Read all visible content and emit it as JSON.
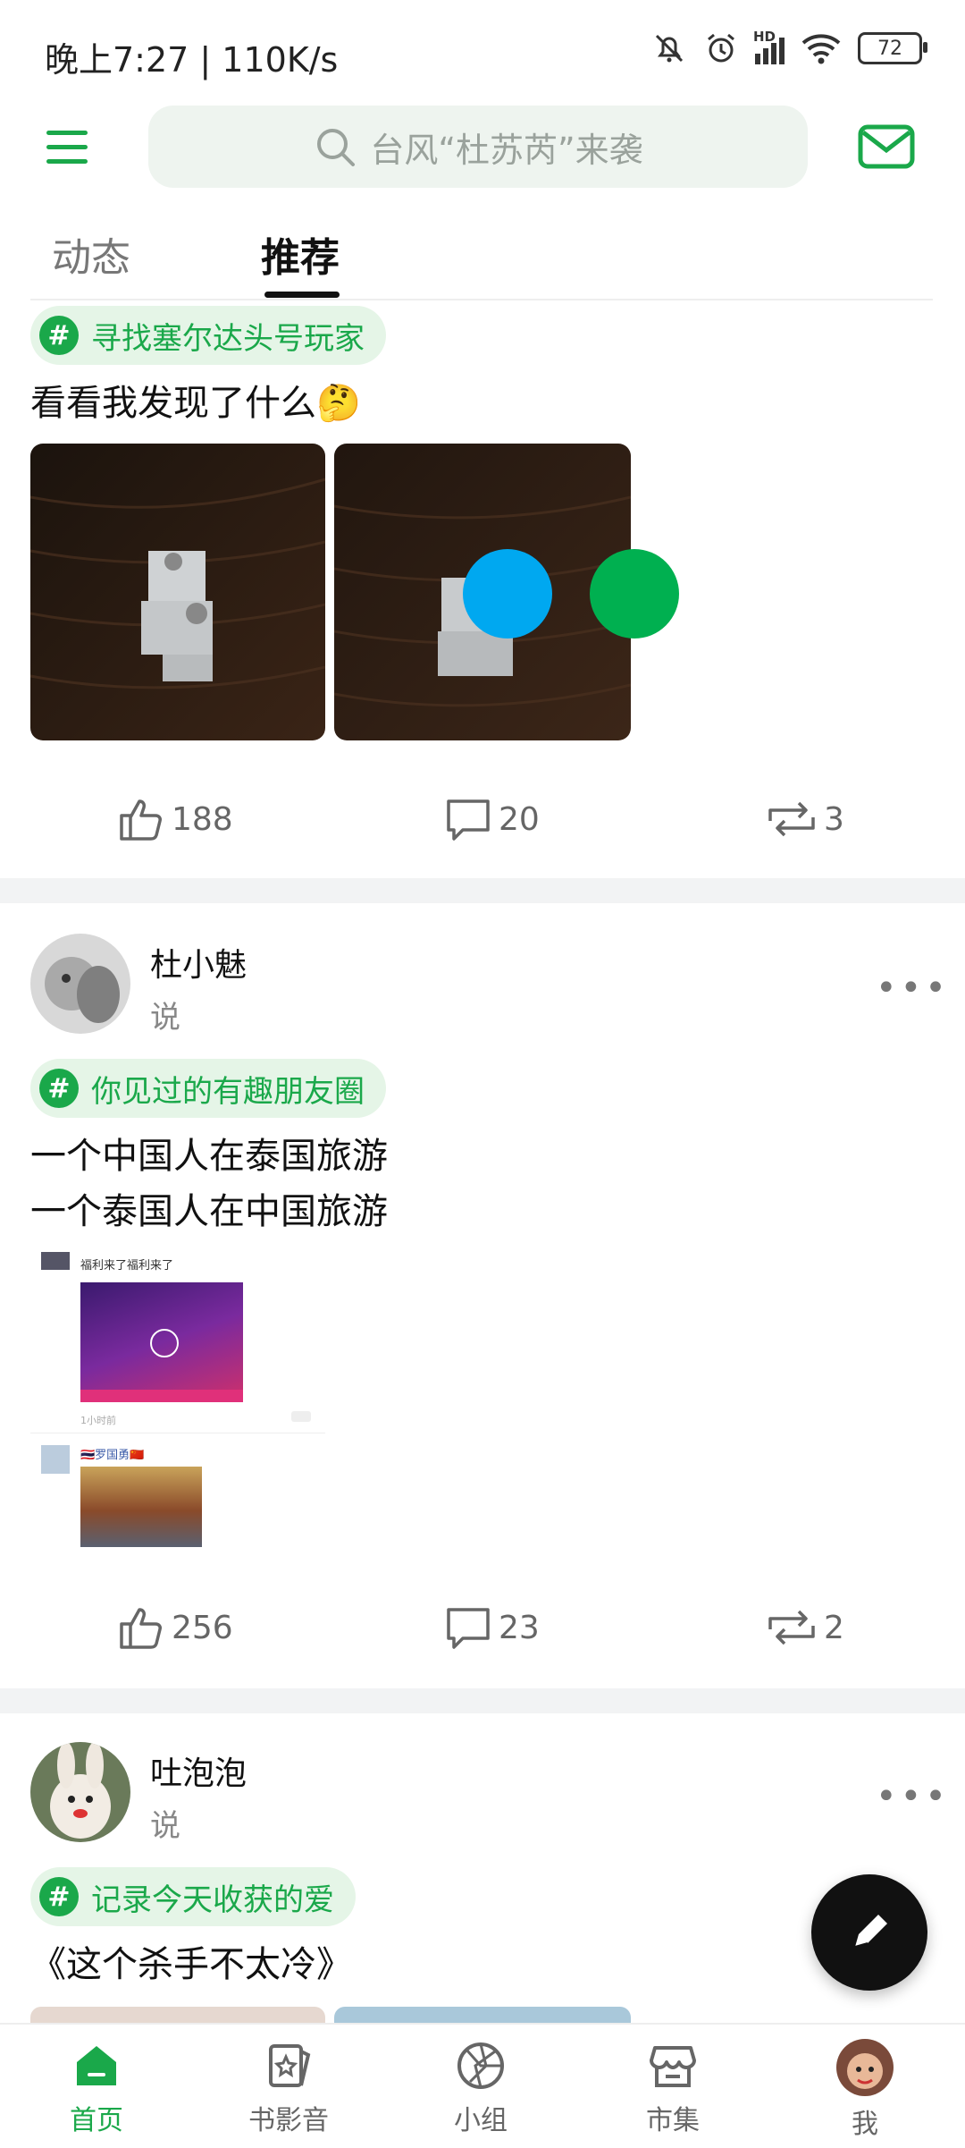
{
  "status_bar": {
    "time_speed": "晚上7:27 | 110K/s",
    "network_badge": "HD",
    "battery": "72"
  },
  "header": {
    "search_placeholder": "台风“杜苏芮”来袭"
  },
  "tabs": [
    {
      "label": "动态",
      "active": false
    },
    {
      "label": "推荐",
      "active": true
    }
  ],
  "posts": [
    {
      "topic": "寻找塞尔达头号玩家",
      "text_lines": [
        "看看我发现了什么🤔"
      ],
      "likes": "188",
      "comments": "20",
      "reposts": "3"
    },
    {
      "username": "杜小魅",
      "say": "说",
      "topic": "你见过的有趣朋友圈",
      "text_lines": [
        "一个中国人在泰国旅游",
        "一个泰国人在中国旅游"
      ],
      "screenshot_caption_1": "福利来了福利来了",
      "screenshot_time": "1小时前",
      "screenshot_name_2": "🇹🇭罗国勇🇨🇳",
      "likes": "256",
      "comments": "23",
      "reposts": "2"
    },
    {
      "username": "吐泡泡",
      "say": "说",
      "topic": "记录今天收获的爱",
      "text_lines": [
        "《这个杀手不太冷》"
      ]
    }
  ],
  "bottom_nav": [
    {
      "label": "首页",
      "icon": "home-icon",
      "active": true
    },
    {
      "label": "书影音",
      "icon": "book-movie-music-icon",
      "active": false
    },
    {
      "label": "小组",
      "icon": "group-icon",
      "active": false
    },
    {
      "label": "市集",
      "icon": "market-icon",
      "active": false
    },
    {
      "label": "我",
      "icon": "avatar",
      "active": false
    }
  ],
  "colors": {
    "accent": "#1aa84a",
    "overlay_blue": "#00a8f0",
    "overlay_green": "#00b050"
  }
}
